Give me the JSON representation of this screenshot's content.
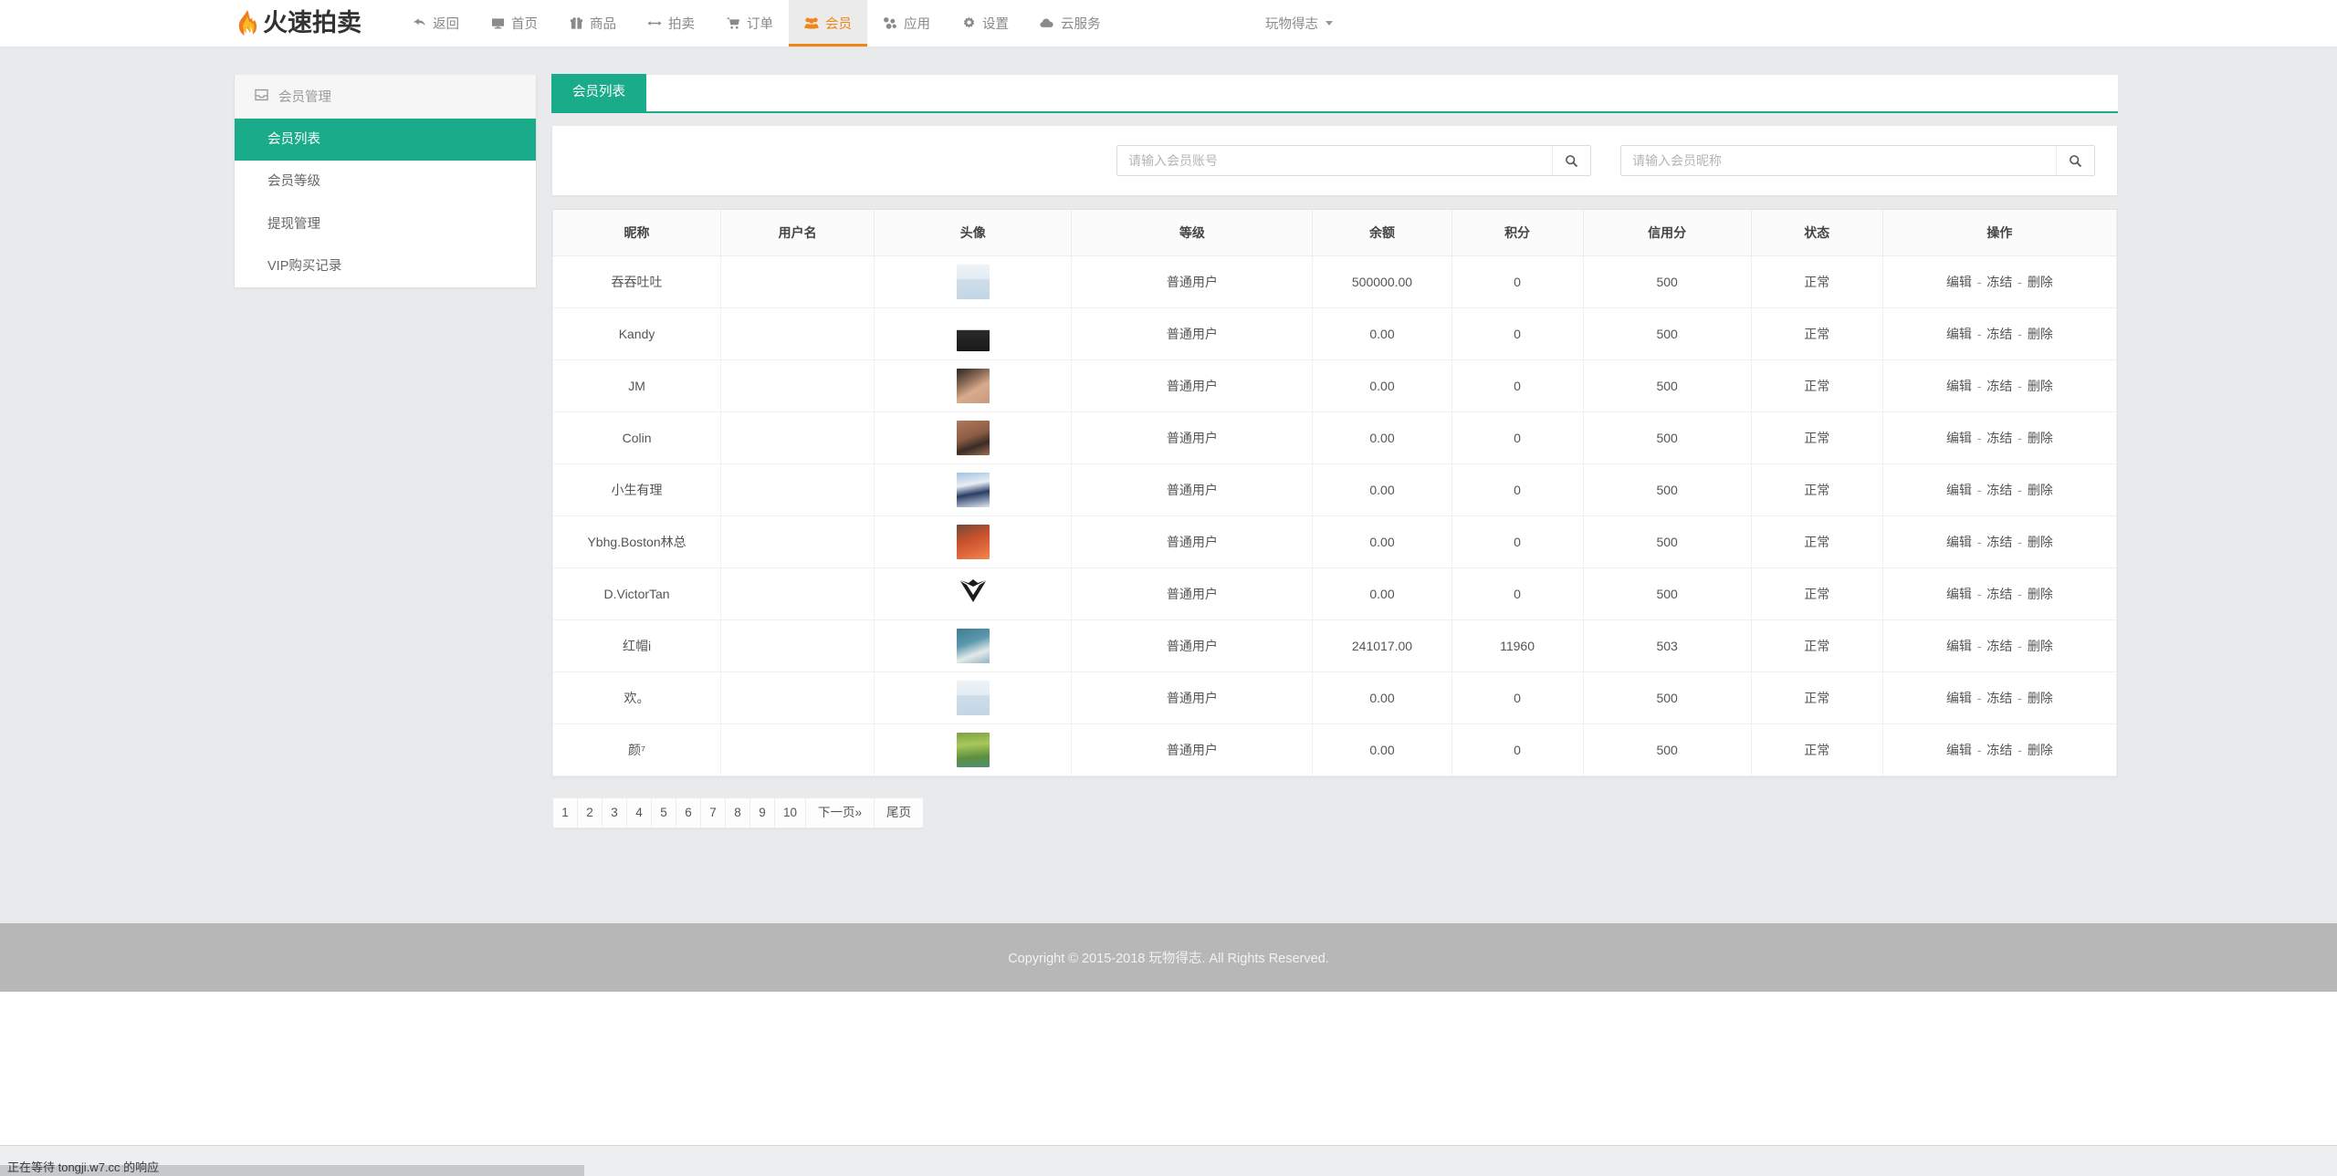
{
  "brand": {
    "name": "火速拍卖",
    "icon": "flame-icon"
  },
  "topnav": {
    "items": [
      {
        "label": "返回",
        "icon": "undo-arrow-icon",
        "active": false
      },
      {
        "label": "首页",
        "icon": "monitor-icon",
        "active": false
      },
      {
        "label": "商品",
        "icon": "gift-icon",
        "active": false
      },
      {
        "label": "拍卖",
        "icon": "arrows-h-icon",
        "active": false
      },
      {
        "label": "订单",
        "icon": "shopping-cart-icon",
        "active": false
      },
      {
        "label": "会员",
        "icon": "users-icon",
        "active": true
      },
      {
        "label": "应用",
        "icon": "sitemap-icon",
        "active": false
      },
      {
        "label": "设置",
        "icon": "gear-icon",
        "active": false
      },
      {
        "label": "云服务",
        "icon": "cloud-icon",
        "active": false
      }
    ],
    "user": {
      "name": "玩物得志",
      "caret": "chevron-down-icon"
    }
  },
  "sidebar": {
    "header": {
      "label": "会员管理",
      "icon": "inbox-icon"
    },
    "items": [
      {
        "label": "会员列表",
        "active": true
      },
      {
        "label": "会员等级",
        "active": false
      },
      {
        "label": "提现管理",
        "active": false
      },
      {
        "label": "VIP购买记录",
        "active": false
      }
    ]
  },
  "content": {
    "tabs": [
      {
        "label": "会员列表",
        "active": true
      }
    ],
    "search": {
      "account": {
        "placeholder": "请输入会员账号",
        "value": "",
        "button_icon": "search-icon"
      },
      "nickname": {
        "placeholder": "请输入会员昵称",
        "value": "",
        "button_icon": "search-icon"
      }
    },
    "table": {
      "columns": [
        "昵称",
        "用户名",
        "头像",
        "等级",
        "余额",
        "积分",
        "信用分",
        "状态",
        "操作"
      ],
      "rows": [
        {
          "nickname": "吞吞吐吐",
          "username": "",
          "avatar": "placeholder-mountain",
          "level": "普通用户",
          "balance": "500000.00",
          "points": "0",
          "credit": "500",
          "status": "正常"
        },
        {
          "nickname": "Kandy",
          "username": "",
          "avatar": "admin-badge",
          "level": "普通用户",
          "balance": "0.00",
          "points": "0",
          "credit": "500",
          "status": "正常"
        },
        {
          "nickname": "JM",
          "username": "",
          "avatar": "portrait-woman",
          "level": "普通用户",
          "balance": "0.00",
          "points": "0",
          "credit": "500",
          "status": "正常"
        },
        {
          "nickname": "Colin",
          "username": "",
          "avatar": "photo-brown",
          "level": "普通用户",
          "balance": "0.00",
          "points": "0",
          "credit": "500",
          "status": "正常"
        },
        {
          "nickname": "小生有理",
          "username": "",
          "avatar": "photo-necktie",
          "level": "普通用户",
          "balance": "0.00",
          "points": "0",
          "credit": "500",
          "status": "正常"
        },
        {
          "nickname": "Ybhg.Boston林总",
          "username": "",
          "avatar": "photo-crowd-red",
          "level": "普通用户",
          "balance": "0.00",
          "points": "0",
          "credit": "500",
          "status": "正常"
        },
        {
          "nickname": "D.VictorTan",
          "username": "",
          "avatar": "v-logo",
          "level": "普通用户",
          "balance": "0.00",
          "points": "0",
          "credit": "500",
          "status": "正常"
        },
        {
          "nickname": "红帽i",
          "username": "",
          "avatar": "cat-illustration",
          "level": "普通用户",
          "balance": "241017.00",
          "points": "11960",
          "credit": "503",
          "status": "正常"
        },
        {
          "nickname": "欢。",
          "username": "",
          "avatar": "placeholder-mountain",
          "level": "普通用户",
          "balance": "0.00",
          "points": "0",
          "credit": "500",
          "status": "正常"
        },
        {
          "nickname": "颜⁷",
          "username": "",
          "avatar": "photo-green-field",
          "level": "普通用户",
          "balance": "0.00",
          "points": "0",
          "credit": "500",
          "status": "正常"
        }
      ],
      "actions": {
        "edit": "编辑",
        "freeze": "冻结",
        "delete": "删除",
        "separator": "-"
      }
    },
    "pagination": {
      "pages": [
        "1",
        "2",
        "3",
        "4",
        "5",
        "6",
        "7",
        "8",
        "9",
        "10"
      ],
      "next": "下一页»",
      "last": "尾页",
      "current": "1"
    }
  },
  "footer": {
    "text": "Copyright © 2015-2018 玩物得志. All Rights Reserved."
  },
  "browser_status": {
    "text": "正在等待 tongji.w7.cc 的响应"
  },
  "colors": {
    "accent_green": "#1aab8a",
    "accent_orange": "#f08519",
    "footer_bg": "#b7b7b7",
    "page_bg": "#e8eaec"
  }
}
